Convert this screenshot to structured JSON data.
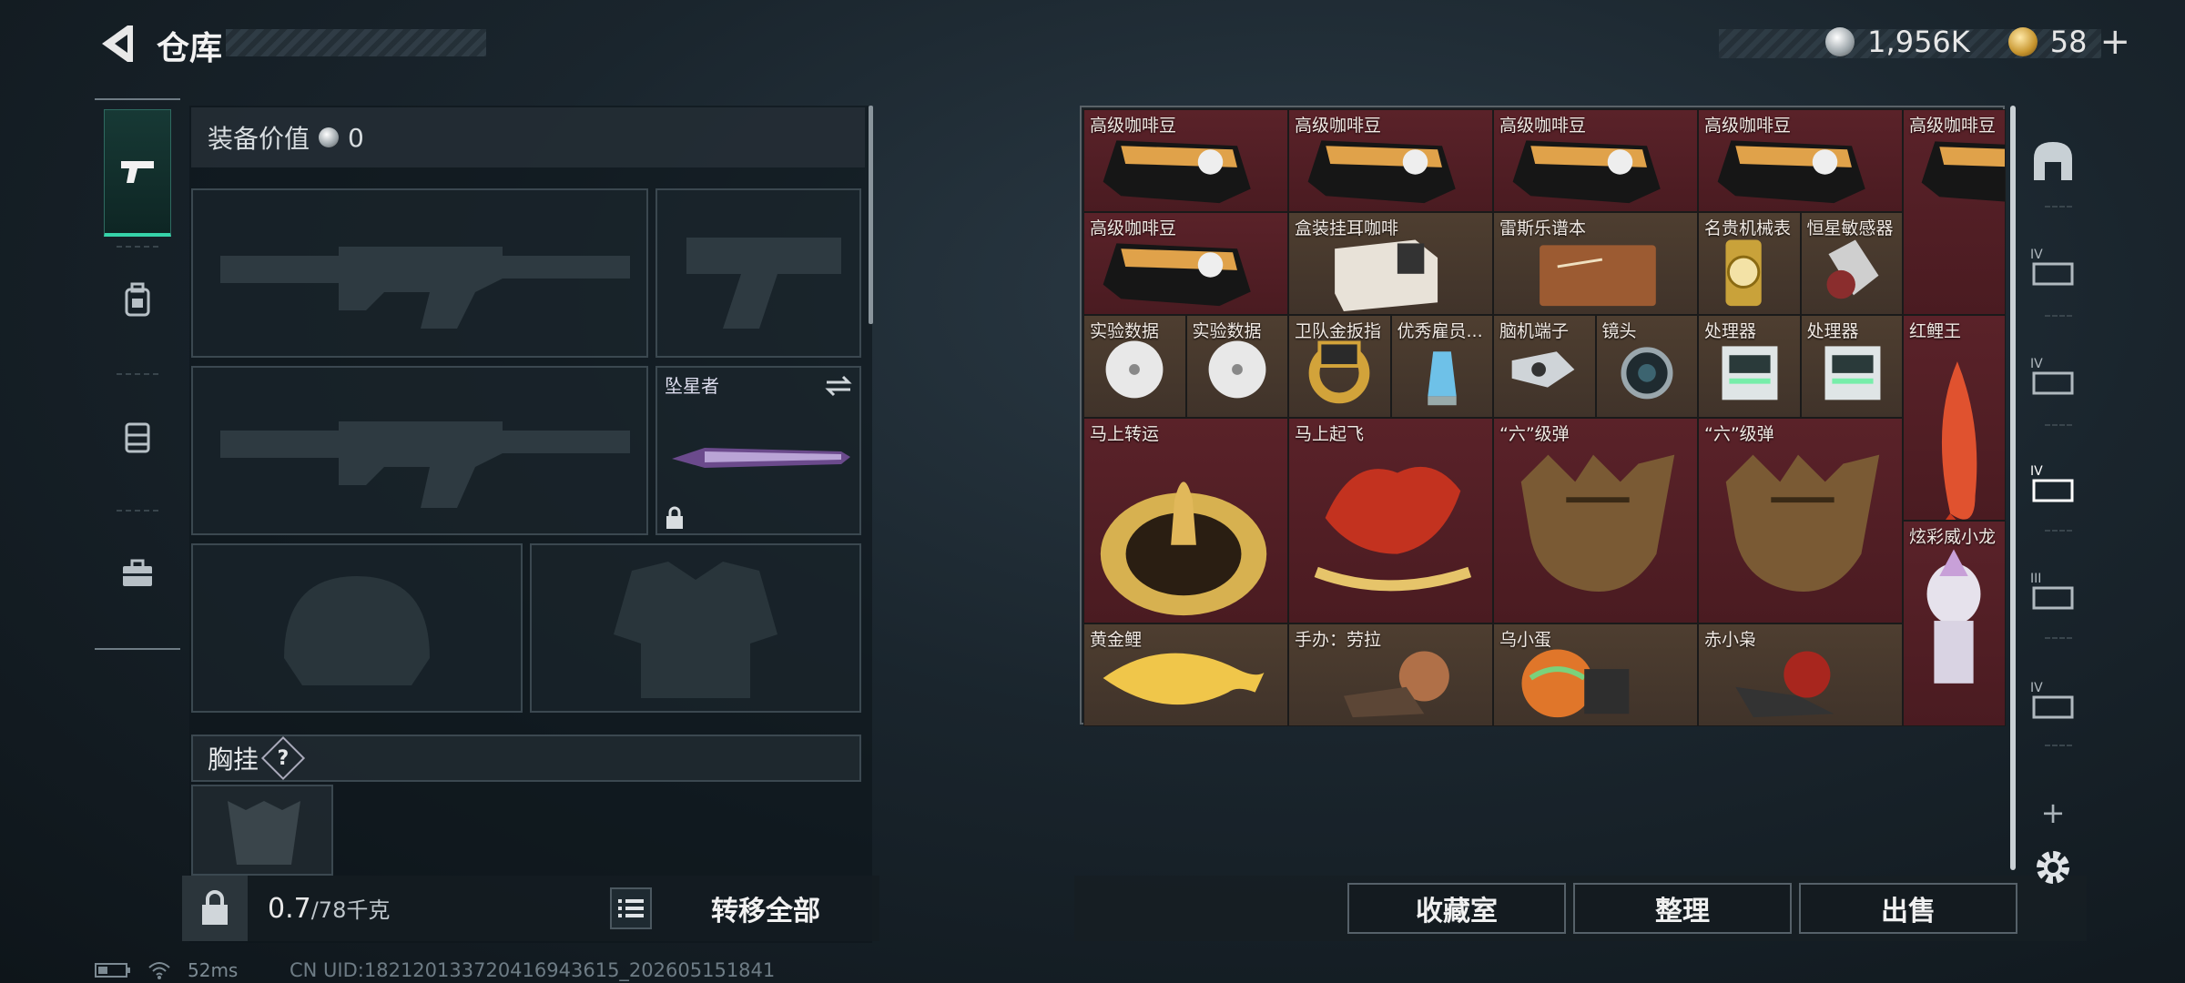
{
  "header": {
    "title": "仓库",
    "silver_amount": "1,956K",
    "gold_amount": "58"
  },
  "loadout": {
    "value_label": "装备价值",
    "value_amount": "0",
    "melee_name": "坠星者",
    "chest_label": "胸挂",
    "chest_help": "?",
    "weight_current": "0.7",
    "weight_max": "/78千克",
    "transfer_all": "转移全部"
  },
  "grid": {
    "items": [
      {
        "name": "高级咖啡豆",
        "rarity": "red",
        "icon": "coffee-bag-icon"
      },
      {
        "name": "高级咖啡豆",
        "rarity": "red",
        "icon": "coffee-bag-icon"
      },
      {
        "name": "高级咖啡豆",
        "rarity": "red",
        "icon": "coffee-bag-icon"
      },
      {
        "name": "高级咖啡豆",
        "rarity": "red",
        "icon": "coffee-bag-icon"
      },
      {
        "name": "高级咖啡豆",
        "rarity": "red",
        "icon": "coffee-bag-icon"
      },
      {
        "name": "高级咖啡豆",
        "rarity": "red",
        "icon": "coffee-bag-icon"
      },
      {
        "name": "盒装挂耳咖啡",
        "rarity": "brown",
        "icon": "coffee-box-icon"
      },
      {
        "name": "雷斯乐谱本",
        "rarity": "brown",
        "icon": "music-book-icon"
      },
      {
        "name": "名贵机械表",
        "rarity": "brown",
        "icon": "watch-icon"
      },
      {
        "name": "恒星敏感器",
        "rarity": "brown",
        "icon": "sensor-icon"
      },
      {
        "name": "实验数据",
        "rarity": "brown",
        "icon": "disc-icon"
      },
      {
        "name": "实验数据",
        "rarity": "brown",
        "icon": "disc-icon"
      },
      {
        "name": "卫队金扳指",
        "rarity": "brown",
        "icon": "gold-ring-icon"
      },
      {
        "name": "优秀雇员...",
        "rarity": "brown",
        "icon": "trophy-icon"
      },
      {
        "name": "脑机端子",
        "rarity": "brown",
        "icon": "device-icon"
      },
      {
        "name": "镜头",
        "rarity": "brown",
        "icon": "lens-icon"
      },
      {
        "name": "处理器",
        "rarity": "brown",
        "icon": "processor-icon"
      },
      {
        "name": "处理器",
        "rarity": "brown",
        "icon": "processor-icon"
      },
      {
        "name": "红鲤王",
        "rarity": "red",
        "icon": "red-carp-icon"
      },
      {
        "name": "马上转运",
        "rarity": "red",
        "icon": "horse-disc-icon"
      },
      {
        "name": "马上起飞",
        "rarity": "red",
        "icon": "red-horse-icon"
      },
      {
        "name": "“六”级弹",
        "rarity": "red",
        "icon": "hand-sculpture-icon"
      },
      {
        "name": "“六”级弹",
        "rarity": "red",
        "icon": "hand-sculpture-icon"
      },
      {
        "name": "炫彩威小龙",
        "rarity": "red",
        "icon": "dragon-figure-icon"
      },
      {
        "name": "黄金鲤",
        "rarity": "brown",
        "icon": "gold-carp-icon"
      },
      {
        "name": "手办：劳拉",
        "rarity": "brown",
        "icon": "figure-icon"
      },
      {
        "name": "乌小蛋",
        "rarity": "brown",
        "icon": "egg-figure-icon"
      },
      {
        "name": "赤小枭",
        "rarity": "brown",
        "icon": "owl-figure-icon"
      }
    ]
  },
  "actions": {
    "collection": "收藏室",
    "organize": "整理",
    "sell": "出售"
  },
  "status": {
    "ping": "52ms",
    "uid": "CN UID:18212013372041694361​5_202605151841"
  },
  "colors": {
    "accent": "#36d3a9",
    "red_rarity": "#5a2229",
    "brown_rarity": "#4e3e30"
  }
}
